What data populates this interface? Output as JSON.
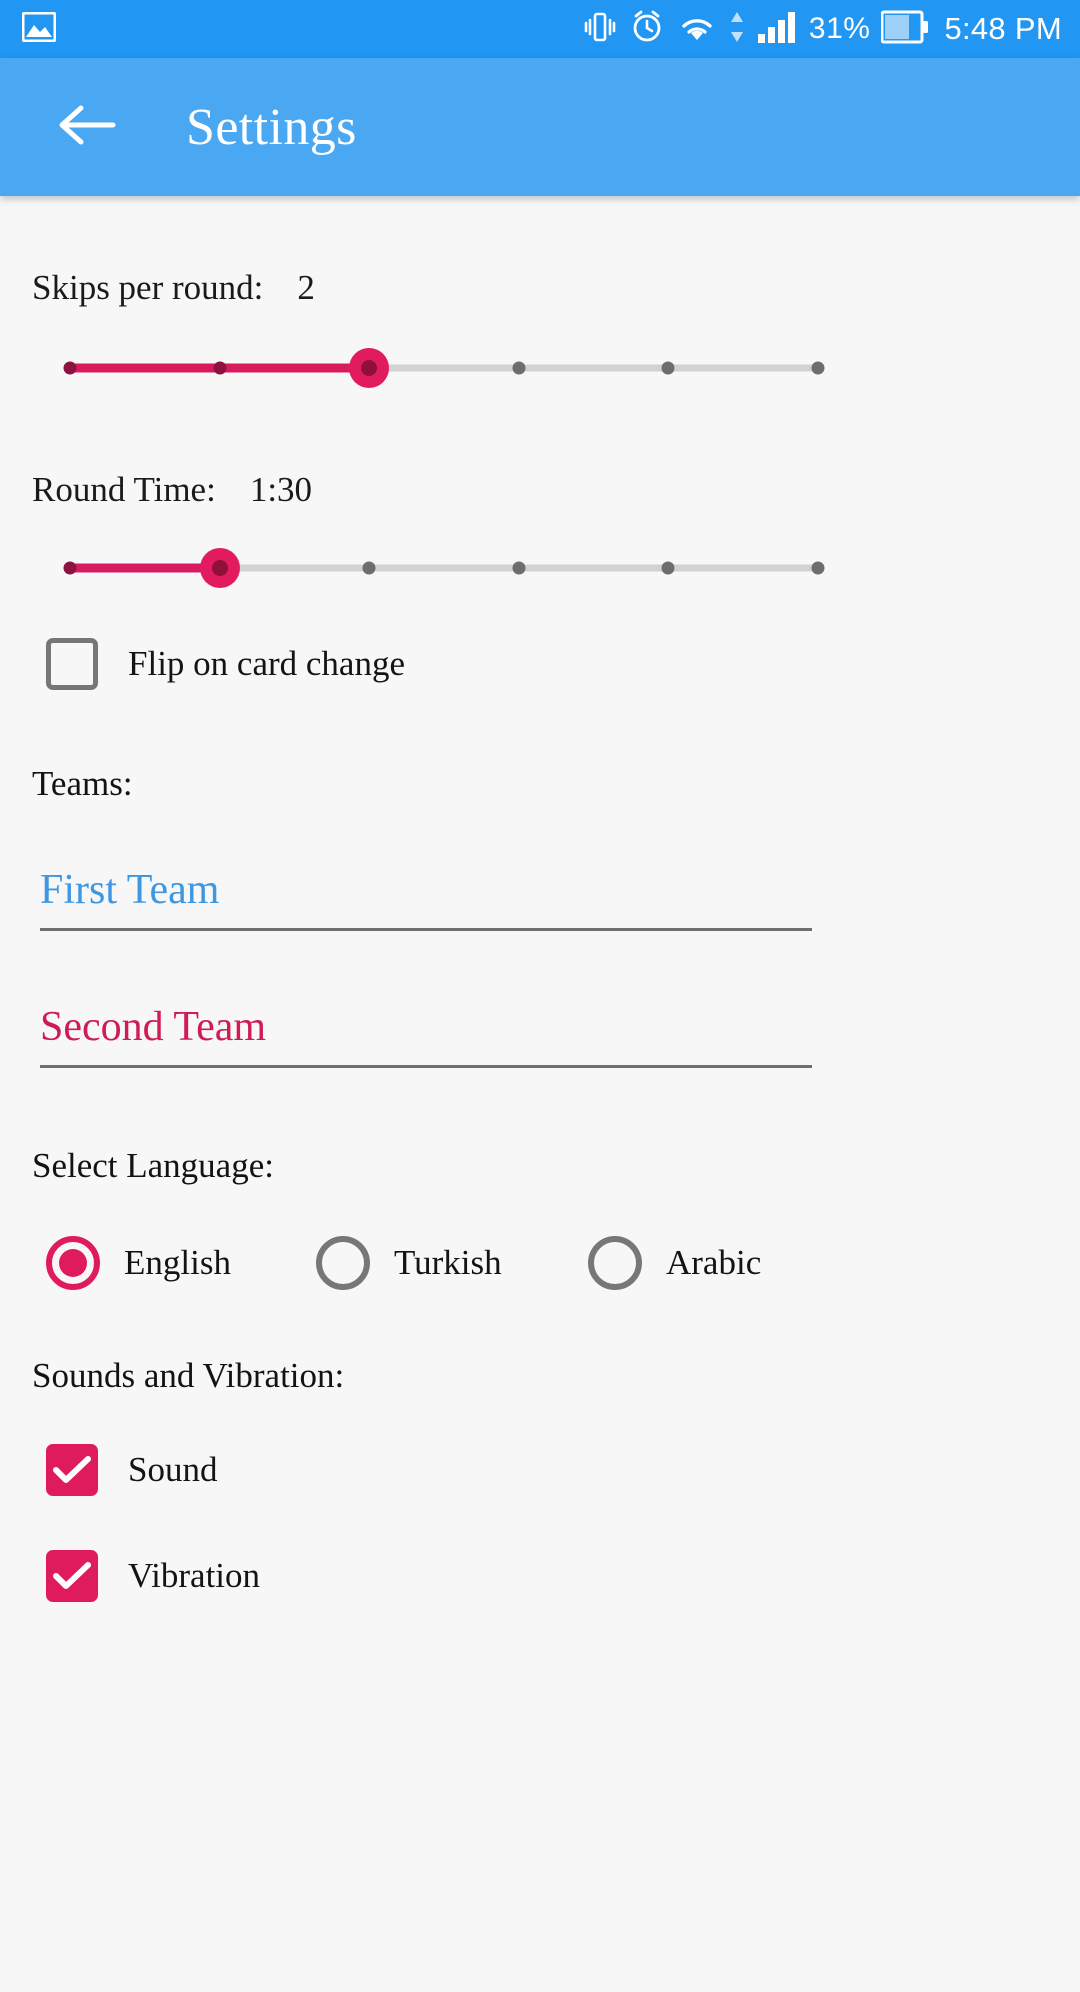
{
  "statusbar": {
    "left_icon": "gallery-image-icon",
    "icons": [
      "vibrate-icon",
      "alarm-icon",
      "wifi-icon",
      "data-transfer-icon",
      "cellular-signal-icon"
    ],
    "battery_percent": "31%",
    "battery_icon": "battery-icon",
    "clock": "5:48 PM",
    "background": "#2196f3"
  },
  "appbar": {
    "back_icon": "back-arrow-icon",
    "title": "Settings",
    "background": "#4aa8f2"
  },
  "settings": {
    "skips": {
      "label": "Skips per round:",
      "value": "2",
      "slider": {
        "min": 0,
        "max": 5,
        "value": 2,
        "ticks": 6
      }
    },
    "round_time": {
      "label": "Round Time:",
      "value": "1:30",
      "slider": {
        "min": 0,
        "max": 5,
        "value": 1,
        "ticks": 6
      }
    },
    "flip_on_card_change": {
      "label": "Flip on card change",
      "checked": false
    },
    "teams": {
      "label": "Teams:",
      "first": {
        "value": "First Team",
        "placeholder": "First Team",
        "color": "#3e97e2"
      },
      "second": {
        "value": "Second Team",
        "placeholder": "Second Team",
        "color": "#cf1c55"
      }
    },
    "language": {
      "label": "Select Language:",
      "options": [
        {
          "label": "English",
          "selected": true
        },
        {
          "label": "Turkish",
          "selected": false
        },
        {
          "label": "Arabic",
          "selected": false
        }
      ]
    },
    "sounds": {
      "label": "Sounds and Vibration:",
      "items": [
        {
          "label": "Sound",
          "checked": true
        },
        {
          "label": "Vibration",
          "checked": true
        }
      ]
    }
  },
  "colors": {
    "accent": "#e01b5d",
    "primary": "#4aa8f2",
    "status": "#2196f3"
  }
}
